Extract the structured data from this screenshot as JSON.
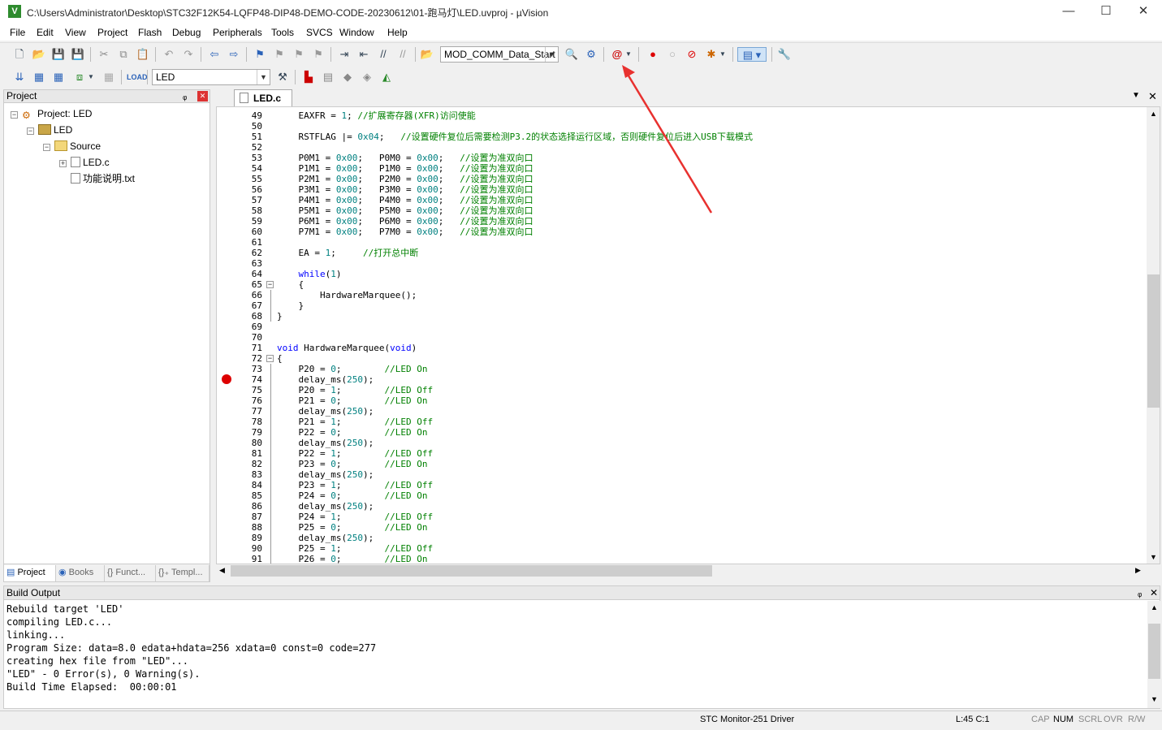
{
  "window": {
    "title": "C:\\Users\\Administrator\\Desktop\\STC32F12K54-LQFP48-DIP48-DEMO-CODE-20230612\\01-跑马灯\\LED.uvproj - µVision",
    "app_icon": "V",
    "minimize": "—",
    "maximize": "☐",
    "close": "✕"
  },
  "menu": [
    "File",
    "Edit",
    "View",
    "Project",
    "Flash",
    "Debug",
    "Peripherals",
    "Tools",
    "SVCS",
    "Window",
    "Help"
  ],
  "toolbar": {
    "find_combo": "MOD_COMM_Data_Start",
    "target_combo": "LED"
  },
  "project_panel": {
    "title": "Project",
    "pin": "ᵩ",
    "close": "✕",
    "tree": {
      "root": "Project: LED",
      "target": "LED",
      "group": "Source",
      "files": [
        "LED.c",
        "功能说明.txt"
      ]
    },
    "tabs": [
      "Project",
      "Books",
      "{} Funct...",
      "{}₊ Templ..."
    ]
  },
  "editor": {
    "tab": "LED.c",
    "lines": [
      {
        "n": "49",
        "t": "    EAXFR = 1; //扩展寄存器(XFR)访问使能"
      },
      {
        "n": "50",
        "t": ""
      },
      {
        "n": "51",
        "t": "    RSTFLAG |= 0x04;   //设置硬件复位后需要检测P3.2的状态选择运行区域，否则硬件复位后进入USB下载模式"
      },
      {
        "n": "52",
        "t": ""
      },
      {
        "n": "53",
        "t": "    P0M1 = 0x00;   P0M0 = 0x00;   //设置为准双向口"
      },
      {
        "n": "54",
        "t": "    P1M1 = 0x00;   P1M0 = 0x00;   //设置为准双向口"
      },
      {
        "n": "55",
        "t": "    P2M1 = 0x00;   P2M0 = 0x00;   //设置为准双向口"
      },
      {
        "n": "56",
        "t": "    P3M1 = 0x00;   P3M0 = 0x00;   //设置为准双向口"
      },
      {
        "n": "57",
        "t": "    P4M1 = 0x00;   P4M0 = 0x00;   //设置为准双向口"
      },
      {
        "n": "58",
        "t": "    P5M1 = 0x00;   P5M0 = 0x00;   //设置为准双向口"
      },
      {
        "n": "59",
        "t": "    P6M1 = 0x00;   P6M0 = 0x00;   //设置为准双向口"
      },
      {
        "n": "60",
        "t": "    P7M1 = 0x00;   P7M0 = 0x00;   //设置为准双向口"
      },
      {
        "n": "61",
        "t": ""
      },
      {
        "n": "62",
        "t": "    EA = 1;     //打开总中断"
      },
      {
        "n": "63",
        "t": ""
      },
      {
        "n": "64",
        "t": "    while(1)"
      },
      {
        "n": "65",
        "t": "    {"
      },
      {
        "n": "66",
        "t": "        HardwareMarquee();"
      },
      {
        "n": "67",
        "t": "    }"
      },
      {
        "n": "68",
        "t": "}"
      },
      {
        "n": "69",
        "t": ""
      },
      {
        "n": "70",
        "t": ""
      },
      {
        "n": "71",
        "t": "void HardwareMarquee(void)"
      },
      {
        "n": "72",
        "t": "{"
      },
      {
        "n": "73",
        "t": "    P20 = 0;        //LED On"
      },
      {
        "n": "74",
        "t": "    delay_ms(250);"
      },
      {
        "n": "75",
        "t": "    P20 = 1;        //LED Off"
      },
      {
        "n": "76",
        "t": "    P21 = 0;        //LED On"
      },
      {
        "n": "77",
        "t": "    delay_ms(250);"
      },
      {
        "n": "78",
        "t": "    P21 = 1;        //LED Off"
      },
      {
        "n": "79",
        "t": "    P22 = 0;        //LED On"
      },
      {
        "n": "80",
        "t": "    delay_ms(250);"
      },
      {
        "n": "81",
        "t": "    P22 = 1;        //LED Off"
      },
      {
        "n": "82",
        "t": "    P23 = 0;        //LED On"
      },
      {
        "n": "83",
        "t": "    delay_ms(250);"
      },
      {
        "n": "84",
        "t": "    P23 = 1;        //LED Off"
      },
      {
        "n": "85",
        "t": "    P24 = 0;        //LED On"
      },
      {
        "n": "86",
        "t": "    delay_ms(250);"
      },
      {
        "n": "87",
        "t": "    P24 = 1;        //LED Off"
      },
      {
        "n": "88",
        "t": "    P25 = 0;        //LED On"
      },
      {
        "n": "89",
        "t": "    delay_ms(250);"
      },
      {
        "n": "90",
        "t": "    P25 = 1;        //LED Off"
      },
      {
        "n": "91",
        "t": "    P26 = 0;        //LED On"
      }
    ],
    "breakpoint_line": "74"
  },
  "build_output": {
    "title": "Build Output",
    "lines": [
      "Rebuild target 'LED'",
      "compiling LED.c...",
      "linking...",
      "Program Size: data=8.0 edata+hdata=256 xdata=0 const=0 code=277",
      "creating hex file from \"LED\"...",
      "\"LED\" - 0 Error(s), 0 Warning(s).",
      "Build Time Elapsed:  00:00:01"
    ]
  },
  "status": {
    "driver": "STC Monitor-251 Driver",
    "position": "L:45 C:1",
    "indicators": [
      "CAP",
      "NUM",
      "SCRL",
      "OVR",
      "R/W"
    ]
  },
  "colors": {
    "comment": "#008000",
    "number": "#008080",
    "keyword": "#0000ff",
    "annotation_arrow": "#e8312f",
    "breakpoint": "#dd0000"
  }
}
